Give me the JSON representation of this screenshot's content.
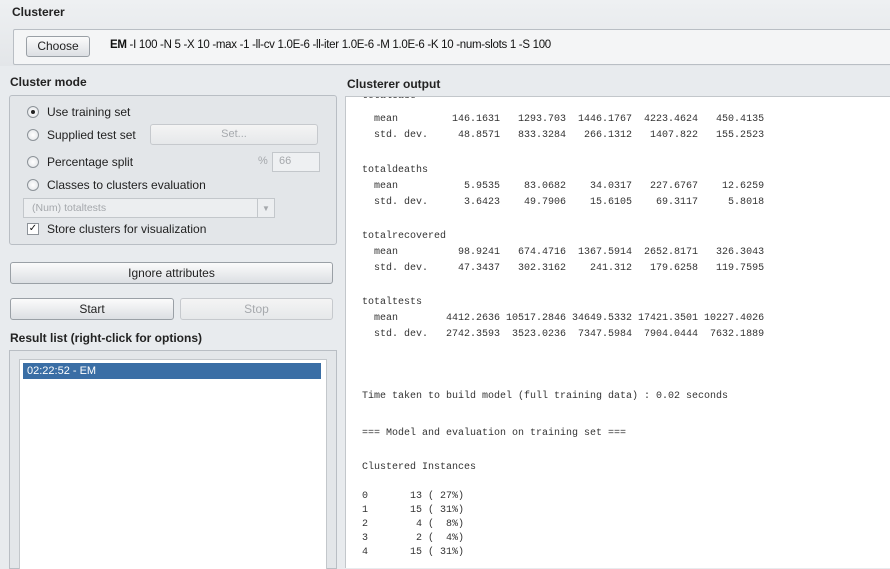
{
  "clusterer": {
    "section_title": "Clusterer",
    "choose_label": "Choose",
    "algo": "EM",
    "options": " -I 100 -N 5 -X 10 -max -1 -ll-cv 1.0E-6 -ll-iter 1.0E-6 -M 1.0E-6 -K 10 -num-slots 1 -S 100"
  },
  "cluster_mode": {
    "section_title": "Cluster mode",
    "use_training": "Use training set",
    "supplied_test": "Supplied test set",
    "set_button": "Set...",
    "percentage_split": "Percentage split",
    "percent_sign": "%",
    "percent_value": "66",
    "classes_to_clusters": "Classes to clusters evaluation",
    "class_attribute": "(Num) totaltests",
    "store_clusters": "Store clusters for visualization",
    "selected_mode": "use_training",
    "store_checked": true
  },
  "controls": {
    "ignore_attributes": "Ignore attributes",
    "start": "Start",
    "stop": "Stop"
  },
  "result_list": {
    "title": "Result list (right-click for options)",
    "items": [
      "02:22:52 - EM"
    ]
  },
  "output": {
    "title": "Clusterer output",
    "lines": [
      "totalcase",
      "  mean         146.1631   1293.703  1446.1767  4223.4624   450.4135",
      "  std. dev.     48.8571   833.3284   266.1312   1407.822   155.2523",
      "",
      "totaldeaths",
      "  mean           5.9535    83.0682    34.0317   227.6767    12.6259",
      "  std. dev.      3.6423    49.7906    15.6105    69.3117     5.8018",
      "",
      "totalrecovered",
      "  mean          98.9241   674.4716  1367.5914  2652.8171   326.3043",
      "  std. dev.     47.3437   302.3162    241.312   179.6258   119.7595",
      "",
      "totaltests",
      "  mean        4412.2636 10517.2846 34649.5332 17421.3501 10227.4026",
      "  std. dev.   2742.3593  3523.0236  7347.5984  7904.0444  7632.1889",
      "",
      "",
      "",
      "Time taken to build model (full training data) : 0.02 seconds",
      "",
      "=== Model and evaluation on training set ===",
      "",
      "Clustered Instances",
      "",
      "0       13 ( 27%)",
      "1       15 ( 31%)",
      "2        4 (  8%)",
      "3        2 (  4%)",
      "4       15 ( 31%)"
    ]
  }
}
